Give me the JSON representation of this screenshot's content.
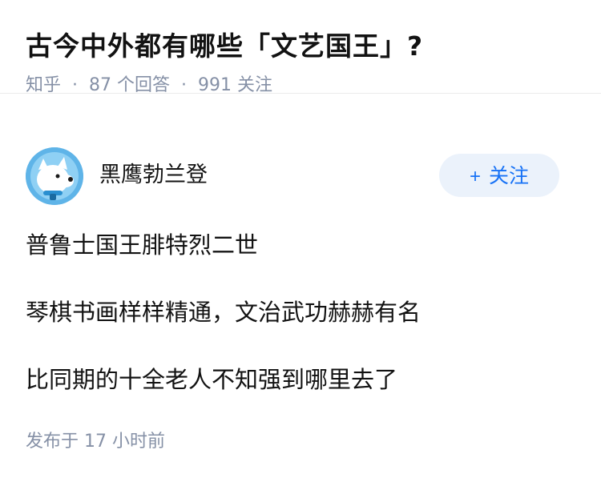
{
  "question": {
    "title": "古今中外都有哪些「文艺国王」?",
    "source": "知乎",
    "answer_count": "87 个回答",
    "follower_count": "991 关注"
  },
  "answer": {
    "author_name": "黑鹰勃兰登",
    "follow_label": "关注",
    "paragraphs": [
      "普鲁士国王腓特烈二世",
      "琴棋书画样样精通，文治武功赫赫有名",
      "比同期的十全老人不知强到哪里去了"
    ],
    "publish_time": "发布于 17 小时前"
  },
  "icons": {
    "avatar": "husky-dog-avatar",
    "follow": "plus-icon"
  },
  "colors": {
    "meta_text": "#8590a6",
    "accent": "#1772f6",
    "follow_bg": "#ebf2fb",
    "avatar_bg": "#5fb4e8"
  }
}
